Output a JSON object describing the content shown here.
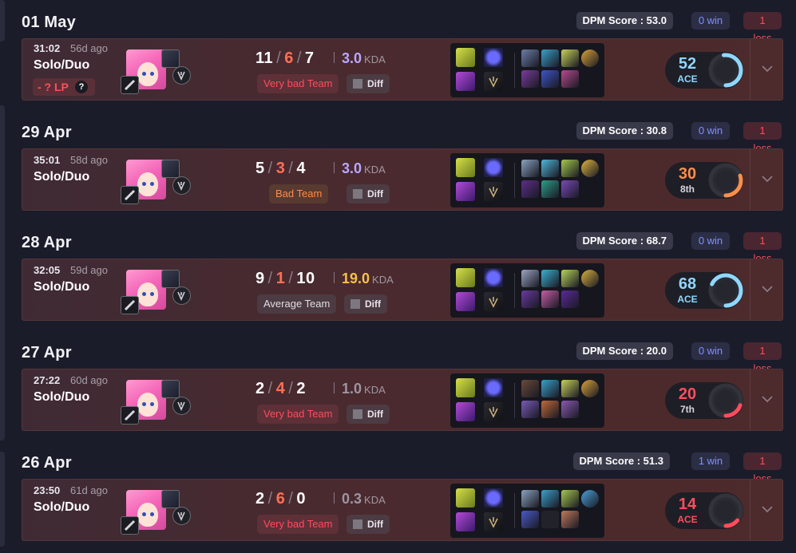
{
  "matches": [
    {
      "date": "01 May",
      "dpm": "DPM Score : 53.0",
      "wins": "0 win",
      "losses": "1 loss",
      "duration": "31:02",
      "ago": "56d ago",
      "queue": "Solo/Duo",
      "lp": "- ? LP",
      "kills": "11",
      "deaths": "6",
      "assists": "7",
      "kda_ratio": "3.0",
      "kda_label": "KDA",
      "kda_color": "#b9a7ff",
      "team": "Very bad Team",
      "team_kind": "vbad",
      "diff": "Diff",
      "score": "52",
      "score_label": "ACE",
      "score_color": "#8fd7ff",
      "score_level": 0.52
    },
    {
      "date": "29 Apr",
      "dpm": "DPM Score : 30.8",
      "wins": "0 win",
      "losses": "1 loss",
      "duration": "35:01",
      "ago": "58d ago",
      "queue": "Solo/Duo",
      "lp": "",
      "kills": "5",
      "deaths": "3",
      "assists": "4",
      "kda_ratio": "3.0",
      "kda_label": "KDA",
      "kda_color": "#b9a7ff",
      "team": "Bad Team",
      "team_kind": "bad",
      "diff": "Diff",
      "score": "30",
      "score_label": "8th",
      "score_color": "#ff8e4a",
      "score_level": 0.3
    },
    {
      "date": "28 Apr",
      "dpm": "DPM Score : 68.7",
      "wins": "0 win",
      "losses": "1 loss",
      "duration": "32:05",
      "ago": "59d ago",
      "queue": "Solo/Duo",
      "lp": "",
      "kills": "9",
      "deaths": "1",
      "assists": "10",
      "kda_ratio": "19.0",
      "kda_label": "KDA",
      "kda_color": "#f5c14a",
      "team": "Average Team",
      "team_kind": "avg",
      "diff": "Diff",
      "score": "68",
      "score_label": "ACE",
      "score_color": "#8fd7ff",
      "score_level": 0.68
    },
    {
      "date": "27 Apr",
      "dpm": "DPM Score : 20.0",
      "wins": "0 win",
      "losses": "1 loss",
      "duration": "27:22",
      "ago": "60d ago",
      "queue": "Solo/Duo",
      "lp": "",
      "kills": "2",
      "deaths": "4",
      "assists": "2",
      "kda_ratio": "1.0",
      "kda_label": "KDA",
      "kda_color": "#9c96a2",
      "team": "Very bad Team",
      "team_kind": "vbad",
      "diff": "Diff",
      "score": "20",
      "score_label": "7th",
      "score_color": "#ff4d5c",
      "score_level": 0.2
    },
    {
      "date": "26 Apr",
      "dpm": "DPM Score : 51.3",
      "wins": "1 win",
      "losses": "1 loss",
      "duration": "23:50",
      "ago": "61d ago",
      "queue": "Solo/Duo",
      "lp": "",
      "kills": "2",
      "deaths": "6",
      "assists": "0",
      "kda_ratio": "0.3",
      "kda_label": "KDA",
      "kda_color": "#9c96a2",
      "team": "Very bad Team",
      "team_kind": "vbad",
      "diff": "Diff",
      "score": "14",
      "score_label": "ACE",
      "score_color": "#ff4d5c",
      "score_level": 0.14
    }
  ],
  "icons": {
    "champion": "seraphine-portrait-icon",
    "rune_primary": "precision-rune-icon",
    "rune_secondary": "sorcery-rune-icon",
    "items": "item-icon",
    "expand": "chevron-down-icon"
  },
  "colors": {
    "background": "#1a1c2a",
    "card": "#4a2a2e",
    "win": "#7f90ff",
    "loss": "#ff4d5c"
  }
}
